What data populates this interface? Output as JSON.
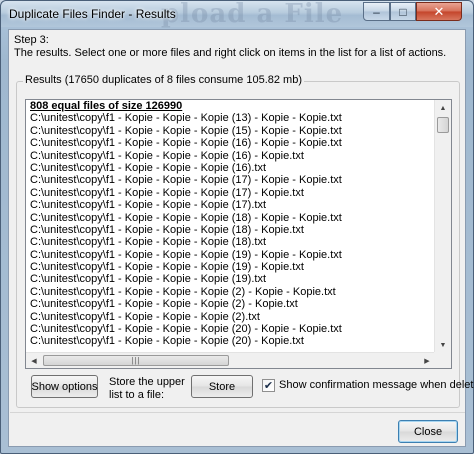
{
  "window": {
    "title": "Duplicate Files Finder - Results",
    "watermark": "pload a File",
    "minimize_glyph": "–",
    "maximize_glyph": "□",
    "close_glyph": "✕"
  },
  "step": {
    "title": "Step 3:",
    "description": "The results. Select one or more files and right click on items in the list for a list of actions."
  },
  "results": {
    "group_label": "Results (17650 duplicates of 8 files consume 105.82 mb)",
    "header": "808 equal files of size 126990",
    "rows": [
      "C:\\unitest\\copy\\f1 - Kopie - Kopie - Kopie (13) - Kopie - Kopie.txt",
      "C:\\unitest\\copy\\f1 - Kopie - Kopie - Kopie (15) - Kopie - Kopie.txt",
      "C:\\unitest\\copy\\f1 - Kopie - Kopie - Kopie (16) - Kopie - Kopie.txt",
      "C:\\unitest\\copy\\f1 - Kopie - Kopie - Kopie (16) - Kopie.txt",
      "C:\\unitest\\copy\\f1 - Kopie - Kopie - Kopie (16).txt",
      "C:\\unitest\\copy\\f1 - Kopie - Kopie - Kopie (17) - Kopie - Kopie.txt",
      "C:\\unitest\\copy\\f1 - Kopie - Kopie - Kopie (17) - Kopie.txt",
      "C:\\unitest\\copy\\f1 - Kopie - Kopie - Kopie (17).txt",
      "C:\\unitest\\copy\\f1 - Kopie - Kopie - Kopie (18) - Kopie - Kopie.txt",
      "C:\\unitest\\copy\\f1 - Kopie - Kopie - Kopie (18) - Kopie.txt",
      "C:\\unitest\\copy\\f1 - Kopie - Kopie - Kopie (18).txt",
      "C:\\unitest\\copy\\f1 - Kopie - Kopie - Kopie (19) - Kopie - Kopie.txt",
      "C:\\unitest\\copy\\f1 - Kopie - Kopie - Kopie (19) - Kopie.txt",
      "C:\\unitest\\copy\\f1 - Kopie - Kopie - Kopie (19).txt",
      "C:\\unitest\\copy\\f1 - Kopie - Kopie - Kopie (2) - Kopie - Kopie.txt",
      "C:\\unitest\\copy\\f1 - Kopie - Kopie - Kopie (2) - Kopie.txt",
      "C:\\unitest\\copy\\f1 - Kopie - Kopie - Kopie (2).txt",
      "C:\\unitest\\copy\\f1 - Kopie - Kopie - Kopie (20) - Kopie - Kopie.txt",
      "C:\\unitest\\copy\\f1 - Kopie - Kopie - Kopie (20) - Kopie.txt"
    ],
    "hscroll_grip": "|||"
  },
  "actions": {
    "show_options": "Show options",
    "store_label_line1": "Store the upper",
    "store_label_line2": "list to a file:",
    "store": "Store",
    "confirm_checked": true,
    "confirm_glyph": "✔",
    "confirm_label": "Show confirmation message when deleting",
    "close": "Close"
  },
  "colors": {
    "close_button": "#c4442a",
    "client_background": "#f0f0f0"
  }
}
